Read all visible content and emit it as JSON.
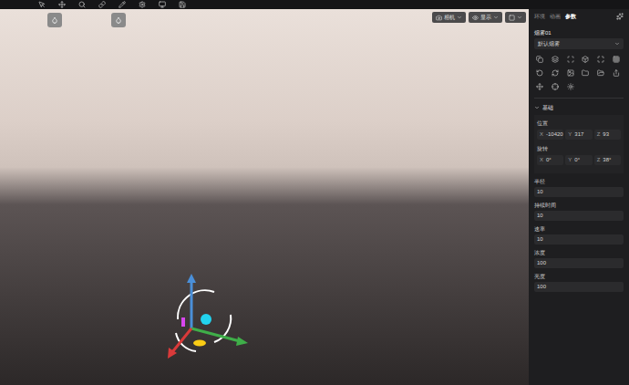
{
  "viewport": {
    "controls": [
      {
        "label": "相机"
      },
      {
        "label": "显示"
      }
    ]
  },
  "panel": {
    "tabs": [
      {
        "label": "环境",
        "selected": false
      },
      {
        "label": "动画",
        "selected": false
      },
      {
        "label": "参数",
        "selected": true
      }
    ],
    "object_name": "烟雾01",
    "preset": "默认烟雾",
    "section": {
      "title": "基础",
      "expanded": true
    },
    "vectors": [
      {
        "label": "位置",
        "axes": [
          {
            "axis": "X",
            "value": "-10420"
          },
          {
            "axis": "Y",
            "value": "317"
          },
          {
            "axis": "Z",
            "value": "93"
          }
        ]
      },
      {
        "label": "旋转",
        "axes": [
          {
            "axis": "X",
            "value": "0°"
          },
          {
            "axis": "Y",
            "value": "0°"
          },
          {
            "axis": "Z",
            "value": "38°"
          }
        ]
      }
    ],
    "fields": [
      {
        "label": "半径",
        "value": "10"
      },
      {
        "label": "持续时间",
        "value": "10"
      },
      {
        "label": "速率",
        "value": "10"
      },
      {
        "label": "浓度",
        "value": "100"
      },
      {
        "label": "亮度",
        "value": "100"
      }
    ]
  }
}
